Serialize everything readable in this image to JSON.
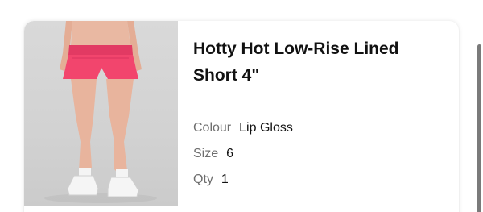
{
  "product": {
    "title": "Hotty Hot Low-Rise Lined Short 4\"",
    "image_alt": "Model wearing Lip Gloss pink running shorts",
    "shorts_color": "#f2456d",
    "attributes": [
      {
        "label": "Colour",
        "value": "Lip Gloss"
      },
      {
        "label": "Size",
        "value": "6"
      },
      {
        "label": "Qty",
        "value": "1"
      }
    ]
  }
}
